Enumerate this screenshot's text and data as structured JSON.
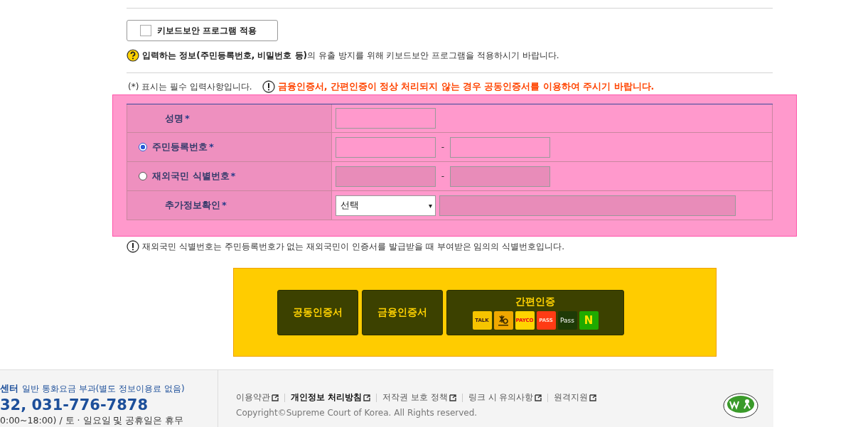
{
  "keyboard_security": {
    "label": "키보드보안 프로그램 적용",
    "checked": false
  },
  "security_notice": "**입력하는 정보(주민등록번호, 비밀번호 등)**의 유출 방지를 위해 키보드보안 프로그램을 적용하시기 바랍니다.",
  "required_note": "(*) 표시는 필수 입력사항입니다.",
  "warning": "금융인증서, 간편인증이 정상 처리되지 않는 경우 공동인증서를 이용하여 주시기 바랍니다.",
  "form_rows": [
    {
      "label": "성명",
      "mark": "*",
      "kind": "plain",
      "fields": [
        {
          "kind": "input",
          "disabled": false
        }
      ]
    },
    {
      "label": "주민등록번호",
      "mark": "*",
      "kind": "radio",
      "selected": true,
      "separator": "-",
      "fields": [
        {
          "kind": "input",
          "disabled": false
        },
        {
          "kind": "input",
          "disabled": false
        }
      ]
    },
    {
      "label": "재외국민 식별번호",
      "mark": "*",
      "kind": "radio",
      "selected": false,
      "separator": "-",
      "fields": [
        {
          "kind": "input",
          "disabled": true
        },
        {
          "kind": "input",
          "disabled": true
        }
      ]
    },
    {
      "label": "추가정보확인",
      "mark": "*",
      "kind": "plain",
      "fields": [
        {
          "kind": "select",
          "value": "선택",
          "caret": "▾"
        },
        {
          "kind": "wide",
          "disabled": true
        }
      ]
    }
  ],
  "foreign_note": "재외국민 식별번호는 주민등록번호가 없는 재외국민이 인증서를 발급받을 때 부여받은 임의의 식별번호입니다.",
  "auth_buttons": [
    {
      "label": "공동인증서"
    },
    {
      "label": "금융인증서"
    },
    {
      "label": "간편인증",
      "logos": [
        {
          "kind": "kakao",
          "text": "TALK"
        },
        {
          "kind": "kb"
        },
        {
          "kind": "payco",
          "text": "PAYCO"
        },
        {
          "kind": "pass",
          "text": "PASS"
        },
        {
          "kind": "samsung",
          "text": "Pass"
        },
        {
          "kind": "naver",
          "text": "N"
        }
      ]
    }
  ],
  "footer": {
    "center_title": "센터",
    "center_note": "일반 통화요금 부과(별도 정보이용료 없음)",
    "phone": "32, 031-776-7878",
    "hours": "0:00~18:00) / 토 · 일요일 및 공휴일은 휴무",
    "links": [
      {
        "label": "이용약관",
        "bold": false
      },
      {
        "label": "개인정보 처리방침",
        "bold": true
      },
      {
        "label": "저작권 보호 정책",
        "bold": false
      },
      {
        "label": "링크 시 유의사항",
        "bold": false
      },
      {
        "label": "원격지원",
        "bold": false
      }
    ],
    "copyright": "Copyright©Supreme Court of Korea. All Rights reserved."
  }
}
